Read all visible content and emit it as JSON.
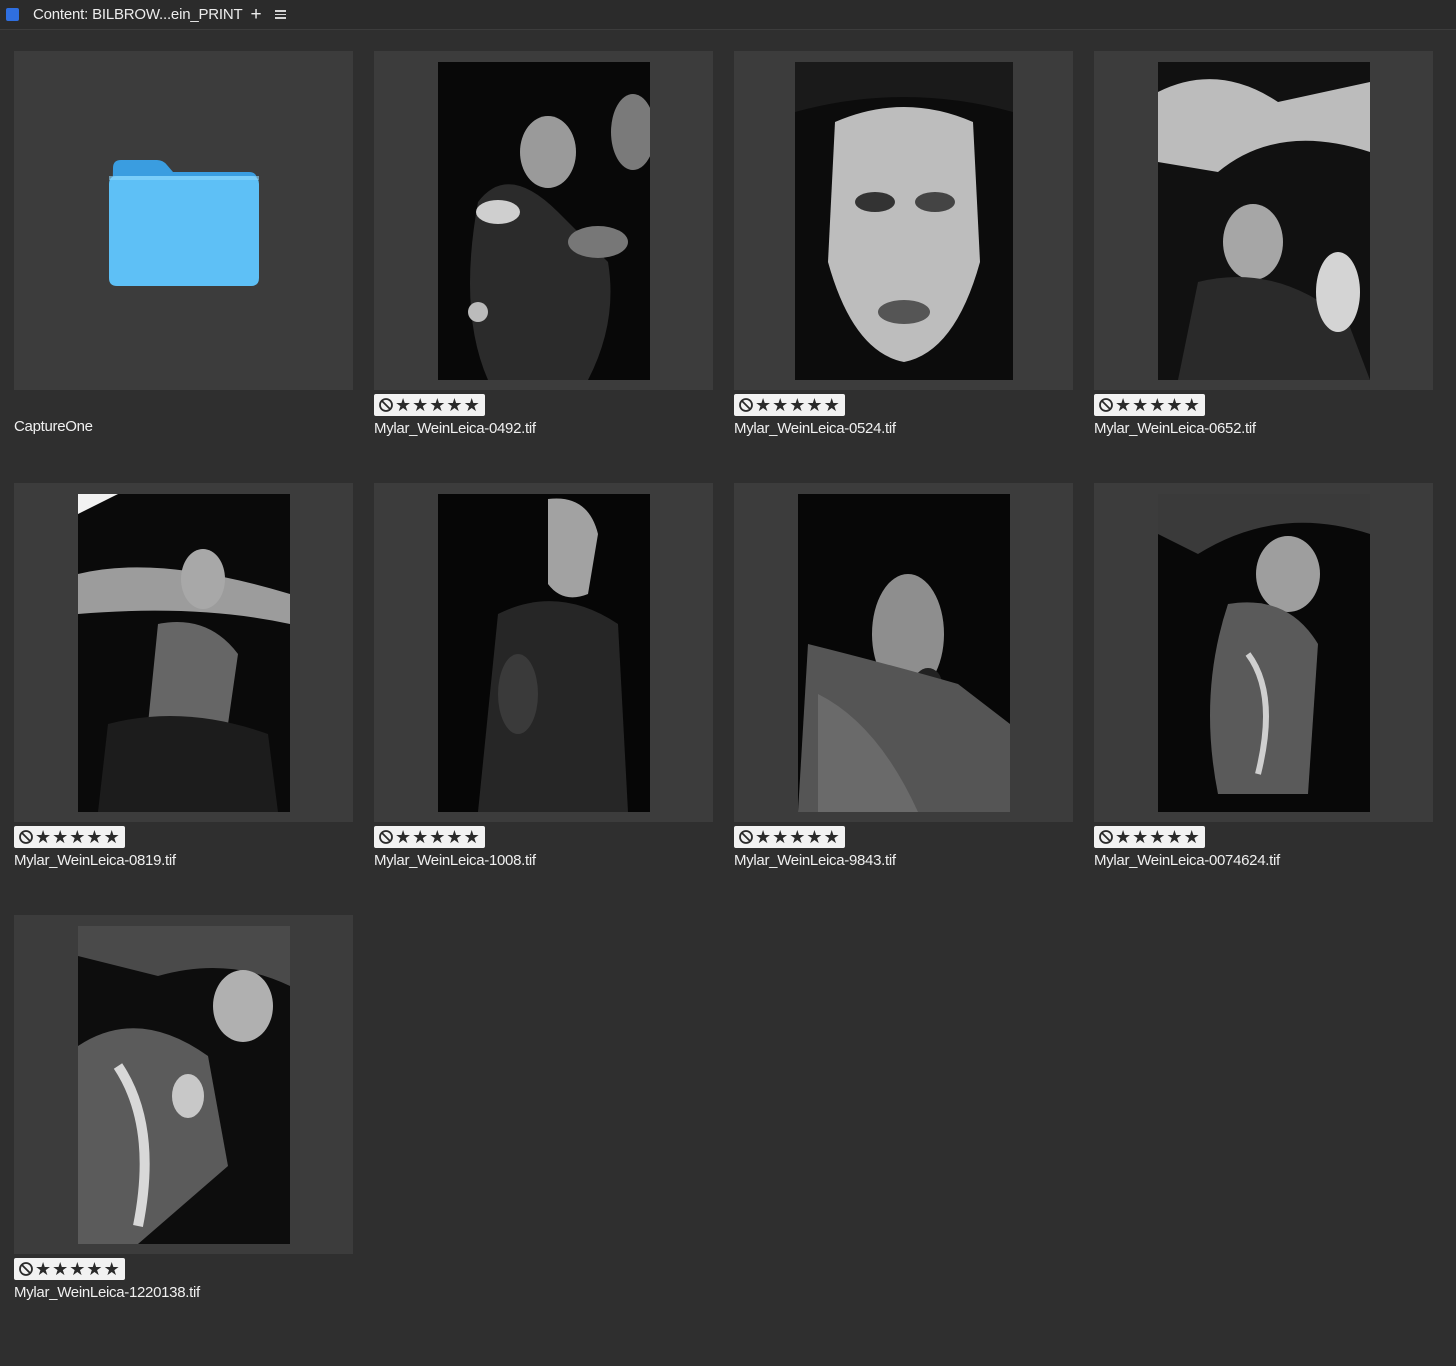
{
  "panel": {
    "title": "Content: BILBROW...ein_PRINT",
    "accent_color": "#2f6fe0",
    "add_icon": "plus-icon",
    "menu_icon": "hamburger-menu-icon"
  },
  "folder": {
    "name": "CaptureOne",
    "icon": "folder-icon",
    "color": "#4fb3f2"
  },
  "items": [
    {
      "filename": "Mylar_WeinLeica-0492.tif",
      "rating": 0,
      "rejected": false
    },
    {
      "filename": "Mylar_WeinLeica-0524.tif",
      "rating": 0,
      "rejected": false
    },
    {
      "filename": "Mylar_WeinLeica-0652.tif",
      "rating": 0,
      "rejected": false
    },
    {
      "filename": "Mylar_WeinLeica-0819.tif",
      "rating": 0,
      "rejected": false
    },
    {
      "filename": "Mylar_WeinLeica-1008.tif",
      "rating": 0,
      "rejected": false
    },
    {
      "filename": "Mylar_WeinLeica-9843.tif",
      "rating": 0,
      "rejected": false
    },
    {
      "filename": "Mylar_WeinLeica-0074624.tif",
      "rating": 0,
      "rejected": false
    },
    {
      "filename": "Mylar_WeinLeica-1220138.tif",
      "rating": 0,
      "rejected": false
    }
  ]
}
